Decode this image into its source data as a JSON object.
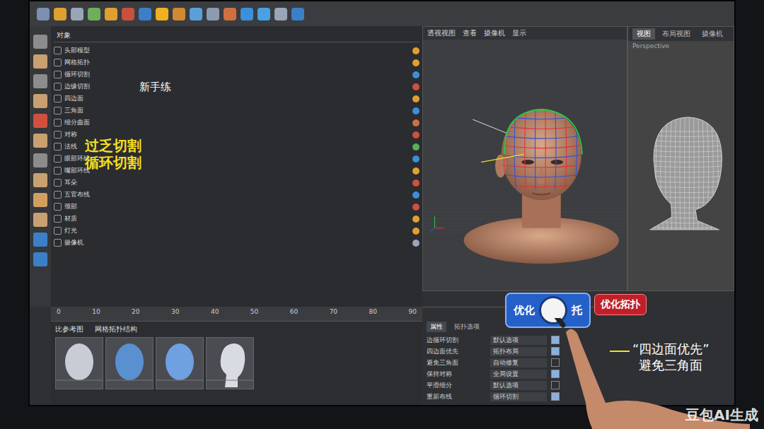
{
  "toolbar": {
    "icons": [
      "#7d8fb0",
      "#e0a030",
      "#9aa6b8",
      "#6fae5a",
      "#e0a030",
      "#c9503c",
      "#3c7fc9",
      "#f0b020",
      "#d08a30",
      "#5aa0d8",
      "#8c9bb0",
      "#d07040",
      "#3c8fd9",
      "#4aa0e0",
      "#9aa6b8",
      "#3c7fc9"
    ]
  },
  "left_tools": {
    "icons": [
      "#8c8c8c",
      "#c9a070",
      "#8c8c8c",
      "#c9a070",
      "#d05040",
      "#c9a070",
      "#8c8c8c",
      "#c9a070",
      "#d0a060",
      "#c9a070",
      "#3c7fc9",
      "#3c7fc9"
    ]
  },
  "viewport_main": {
    "title": "透视视图",
    "menu": [
      "查看",
      "摄像机",
      "显示"
    ]
  },
  "viewport_wire": {
    "tabs": [
      {
        "label": "视图",
        "selected": true
      },
      {
        "label": "布局视图",
        "selected": false
      },
      {
        "label": "摄像机",
        "selected": false
      }
    ],
    "caption": "Perspective"
  },
  "callout_edge": {
    "text": "新手练"
  },
  "callout_cut": {
    "lines": [
      "过乏切割",
      "循环切割"
    ]
  },
  "callout_quad": {
    "lines": [
      "“四边面优先”",
      "避免三角面"
    ]
  },
  "objects_panel": {
    "title": "对象",
    "items": [
      {
        "label": "头部模型",
        "color": "#e0a030"
      },
      {
        "label": "网格拓扑",
        "color": "#e0a030"
      },
      {
        "label": "循环切割",
        "color": "#3c8fd9"
      },
      {
        "label": "边缘切割",
        "color": "#d05040"
      },
      {
        "label": "四边面",
        "color": "#e0a030"
      },
      {
        "label": "三角面",
        "color": "#3c8fd9"
      },
      {
        "label": "细分曲面",
        "color": "#d07040"
      },
      {
        "label": "对称",
        "color": "#d05040"
      },
      {
        "label": "法线",
        "color": "#5aae5a"
      },
      {
        "label": "眼部环线",
        "color": "#3c8fd9"
      },
      {
        "label": "嘴部环线",
        "color": "#e0a030"
      },
      {
        "label": "耳朵",
        "color": "#d05040"
      },
      {
        "label": "五官布线",
        "color": "#3c8fd9"
      },
      {
        "label": "颈部",
        "color": "#d05040"
      },
      {
        "label": "材质",
        "color": "#e0a030"
      },
      {
        "label": "灯光",
        "color": "#e0a030"
      },
      {
        "label": "摄像机",
        "color": "#9aa6b8"
      }
    ]
  },
  "timeline": {
    "ticks": [
      "0",
      "10",
      "20",
      "30",
      "40",
      "50",
      "60",
      "70",
      "80",
      "90"
    ]
  },
  "thumbnails": {
    "title": "比参考图",
    "subtitle": "网格拓扑结构",
    "items": [
      {
        "kind": "front",
        "color": "#c8ccd4"
      },
      {
        "kind": "front",
        "color": "#5a8fd0"
      },
      {
        "kind": "front",
        "color": "#6fa0e0"
      },
      {
        "kind": "side",
        "color": "#d8dce2"
      }
    ]
  },
  "properties": {
    "tabs": [
      {
        "label": "属性",
        "selected": true
      },
      {
        "label": "拓扑选项",
        "selected": false
      }
    ],
    "rows": [
      {
        "label": "边循环切割",
        "value": "默认选项",
        "checked": true
      },
      {
        "label": "四边面优先",
        "value": "拓扑布局",
        "checked": true
      },
      {
        "label": "避免三角面",
        "value": "自动修复",
        "checked": false
      },
      {
        "label": "保持对称",
        "value": "全局设置",
        "checked": true
      },
      {
        "label": "平滑细分",
        "value": "默认选项",
        "checked": false
      },
      {
        "label": "重新布线",
        "value": "循环切割",
        "checked": true
      }
    ]
  },
  "buttons": {
    "toggle": {
      "left": "优化",
      "right": "托",
      "on": true
    },
    "action": {
      "label": "优化拓扑"
    }
  },
  "watermark": "豆包AI生成"
}
